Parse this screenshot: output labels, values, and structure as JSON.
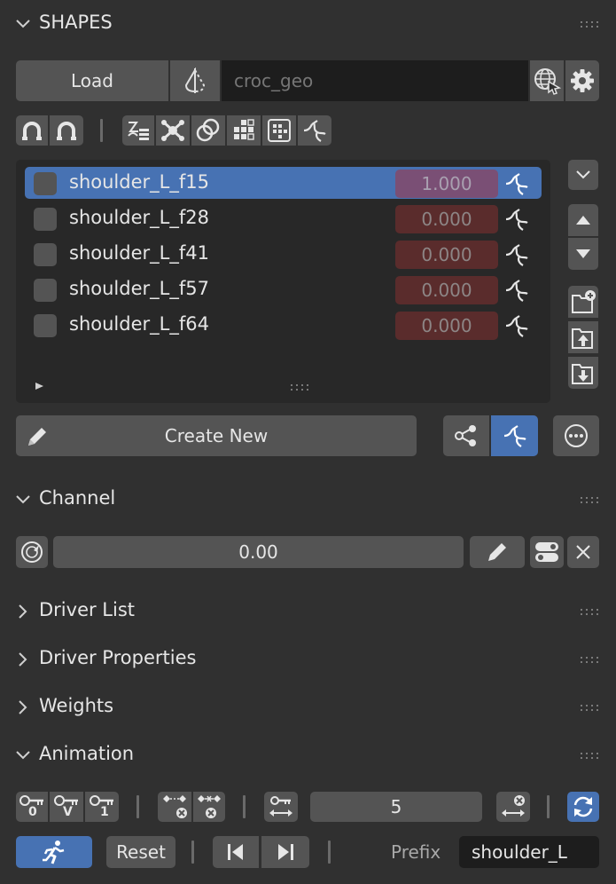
{
  "shapes": {
    "title": "SHAPES",
    "load_label": "Load",
    "geo_value": "croc_geo",
    "list": [
      {
        "name": "shoulder_L_f15",
        "value": "1.000",
        "selected": true
      },
      {
        "name": "shoulder_L_f28",
        "value": "0.000",
        "selected": false
      },
      {
        "name": "shoulder_L_f41",
        "value": "0.000",
        "selected": false
      },
      {
        "name": "shoulder_L_f57",
        "value": "0.000",
        "selected": false
      },
      {
        "name": "shoulder_L_f64",
        "value": "0.000",
        "selected": false
      }
    ],
    "create_label": "Create New"
  },
  "channel": {
    "title": "Channel",
    "value": "0.00"
  },
  "panels": {
    "driver_list": "Driver List",
    "driver_properties": "Driver Properties",
    "weights": "Weights"
  },
  "animation": {
    "title": "Animation",
    "step_value": "5",
    "reset_label": "Reset",
    "prefix_label": "Prefix",
    "prefix_value": "shoulder_L",
    "key_labels": [
      "0",
      "V",
      "1"
    ]
  },
  "colors": {
    "background": "#303030",
    "button": "#545454",
    "field": "#1d1d1d",
    "accent": "#4772b3",
    "value_red": "#5a2c2c"
  },
  "icons": [
    "chevron-down-icon",
    "mirror-icon",
    "globe-icon",
    "gear-icon",
    "magnet-icon",
    "shape-key-icon",
    "more-icon",
    "pencil-icon",
    "share-icon",
    "folder-add-icon",
    "folder-up-icon",
    "folder-down-icon",
    "arrow-up-icon",
    "arrow-down-icon",
    "run-icon",
    "refresh-icon",
    "key-icon",
    "close-icon"
  ]
}
